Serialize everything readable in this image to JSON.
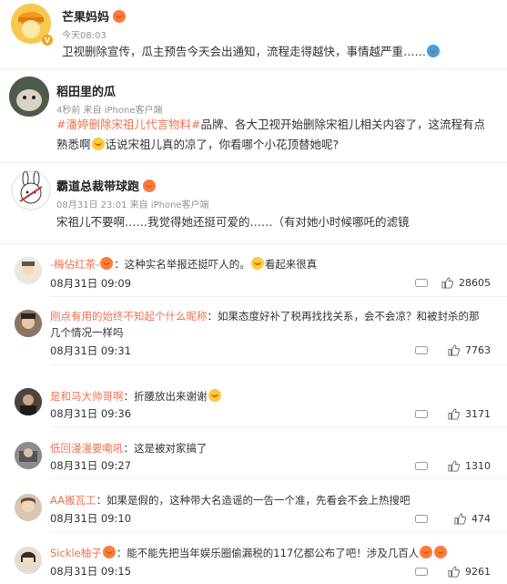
{
  "post1": {
    "username": "芒果妈妈",
    "time": "今天08:03",
    "text": "卫视删除宣传，瓜主预告今天会出通知，流程走得越快，事情越严重……"
  },
  "post2": {
    "username": "稻田里的瓜",
    "meta": "4秒前  来自 iPhone客户端",
    "topic": "#潘婷删除宋祖儿代言物料#",
    "text": "品牌、各大卫视开始删除宋祖儿相关内容了，这流程有点熟悉啊",
    "text2": "话说宋祖儿真的凉了，你看哪个小花顶替她呢?"
  },
  "post3": {
    "username": "霸道总裁带球跑",
    "meta": "08月31日 23:01  来自 iPhone客户端",
    "text": "宋祖儿不要啊……我觉得她还挺可爱的……（有对她小时候哪吒的滤镜"
  },
  "comments": [
    {
      "name": "-梅佔红茶-",
      "text": "：这种实名举报还挺吓人的。",
      "text_after": "看起来很真",
      "time": "08月31日 09:09",
      "likes": "28605"
    },
    {
      "name": "刚点有用的始终不知起个什么昵称",
      "text": "：如果态度好补了税再找找关系，会不会凉？和被封杀的那几个情况一样吗",
      "time": "08月31日 09:31",
      "likes": "7763"
    },
    {
      "name": "是和马大帅哥啊",
      "text": "：折腰放出来谢谢",
      "time": "08月31日 09:36",
      "likes": "3171"
    },
    {
      "name": "低回漫漫要嘞吼",
      "text": "：这是被对家搞了",
      "time": "08月31日 09:27",
      "likes": "1310"
    },
    {
      "name": "AA搬瓦工",
      "text": "：如果是假的，这种带大名造谣的一告一个准，先看会不会上热搜吧",
      "time": "08月31日 09:10",
      "likes": "474"
    },
    {
      "name": "Sickle柚子",
      "text": "：能不能先把当年娱乐圈偷漏税的117亿都公布了吧！涉及几百人",
      "time": "08月31日 09:15",
      "likes": "9261"
    }
  ],
  "colors": {
    "accent": "#eb7350",
    "badge": "#f7a218"
  }
}
